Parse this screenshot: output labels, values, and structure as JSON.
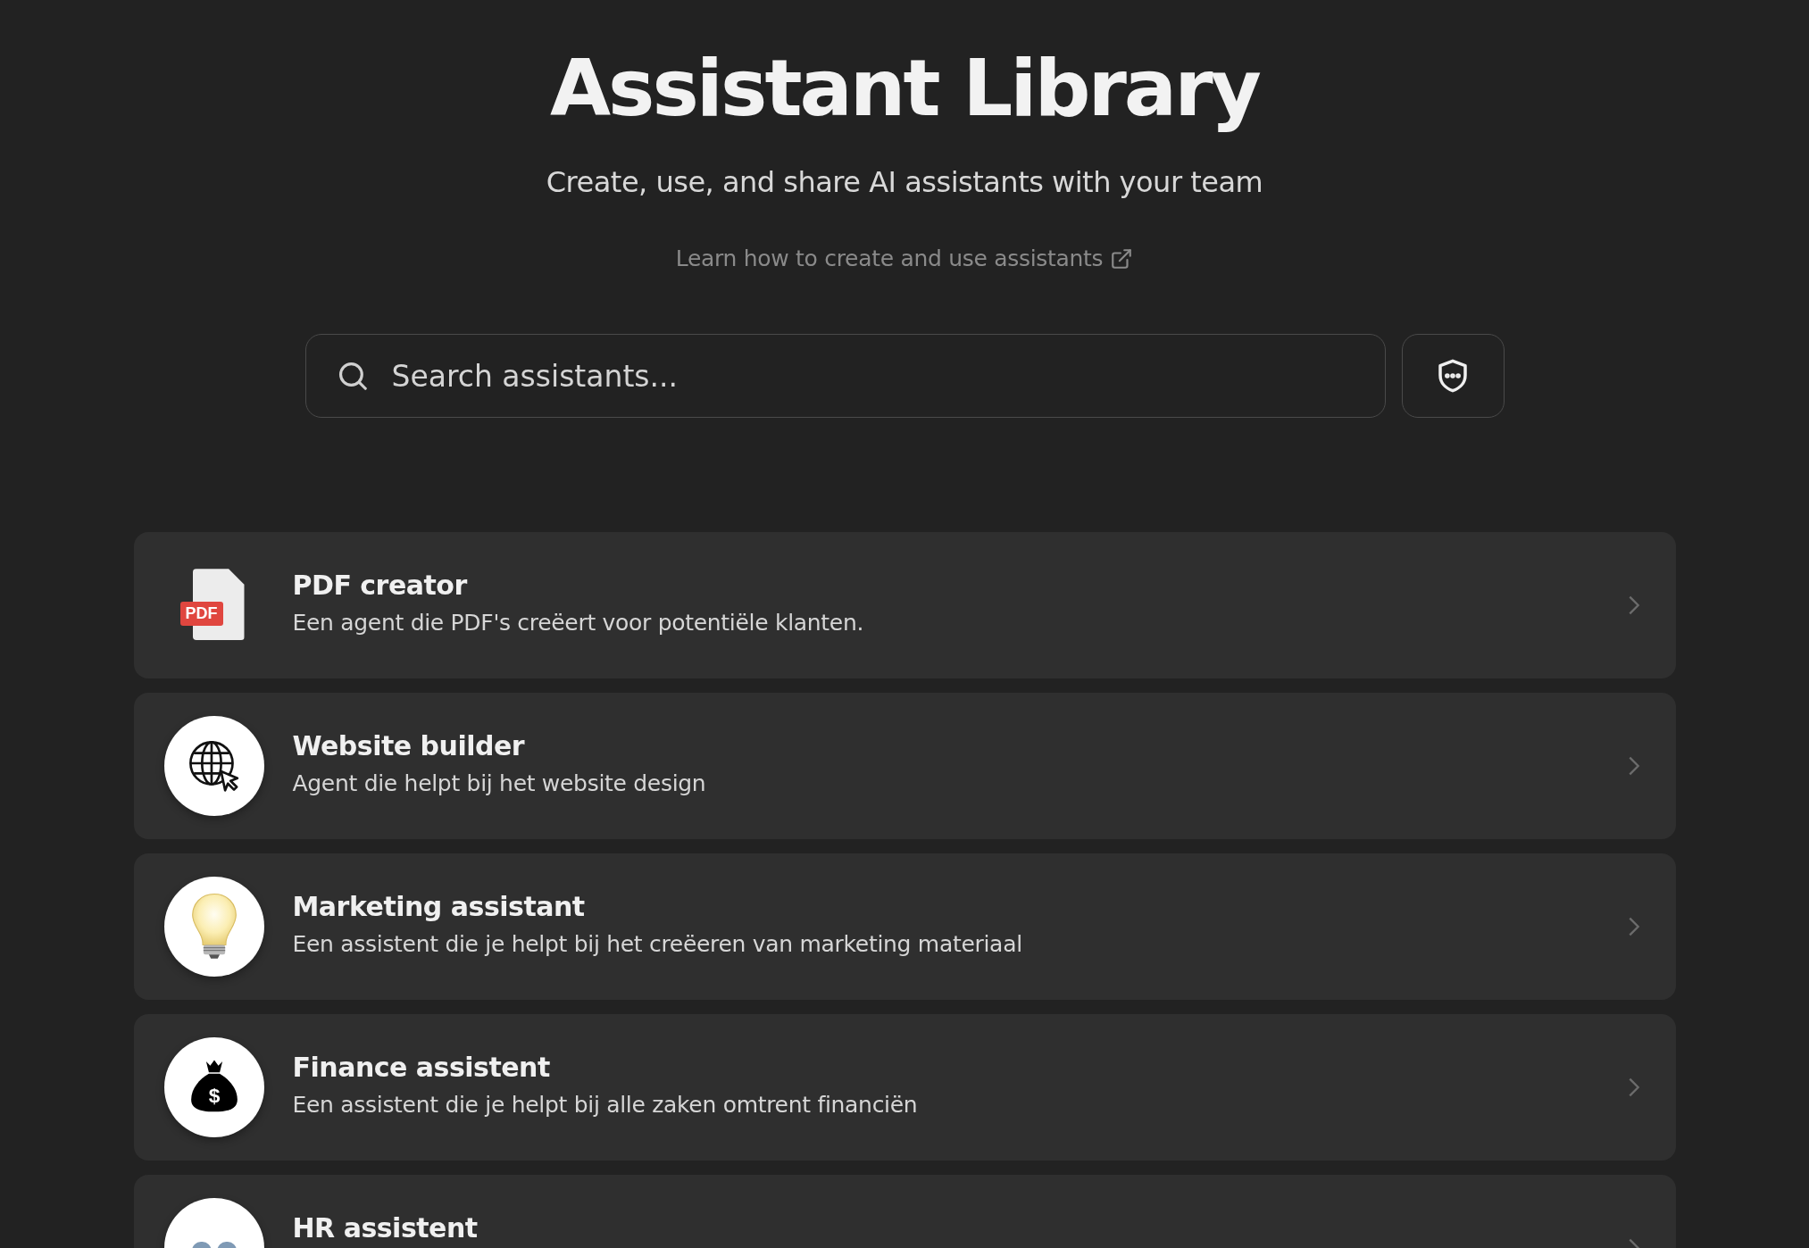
{
  "header": {
    "title": "Assistant Library",
    "subtitle": "Create, use, and share AI assistants with your team",
    "help_link": "Learn how to create and use assistants"
  },
  "search": {
    "placeholder": "Search assistants..."
  },
  "assistants": [
    {
      "kind": "pdf",
      "name": "PDF creator",
      "description": "Een agent die PDF's creëert voor potentiële klanten.",
      "icon_label": "PDF"
    },
    {
      "kind": "globe",
      "name": "Website builder",
      "description": "Agent die helpt bij het website design"
    },
    {
      "kind": "bulb",
      "name": "Marketing assistant",
      "description": "Een assistent die je helpt bij het creëeren van marketing materiaal"
    },
    {
      "kind": "money",
      "name": "Finance assistent",
      "description": "Een assistent die je helpt bij alle zaken omtrent financiën",
      "icon_label": "$"
    },
    {
      "kind": "people",
      "name": "HR assistent"
    }
  ]
}
